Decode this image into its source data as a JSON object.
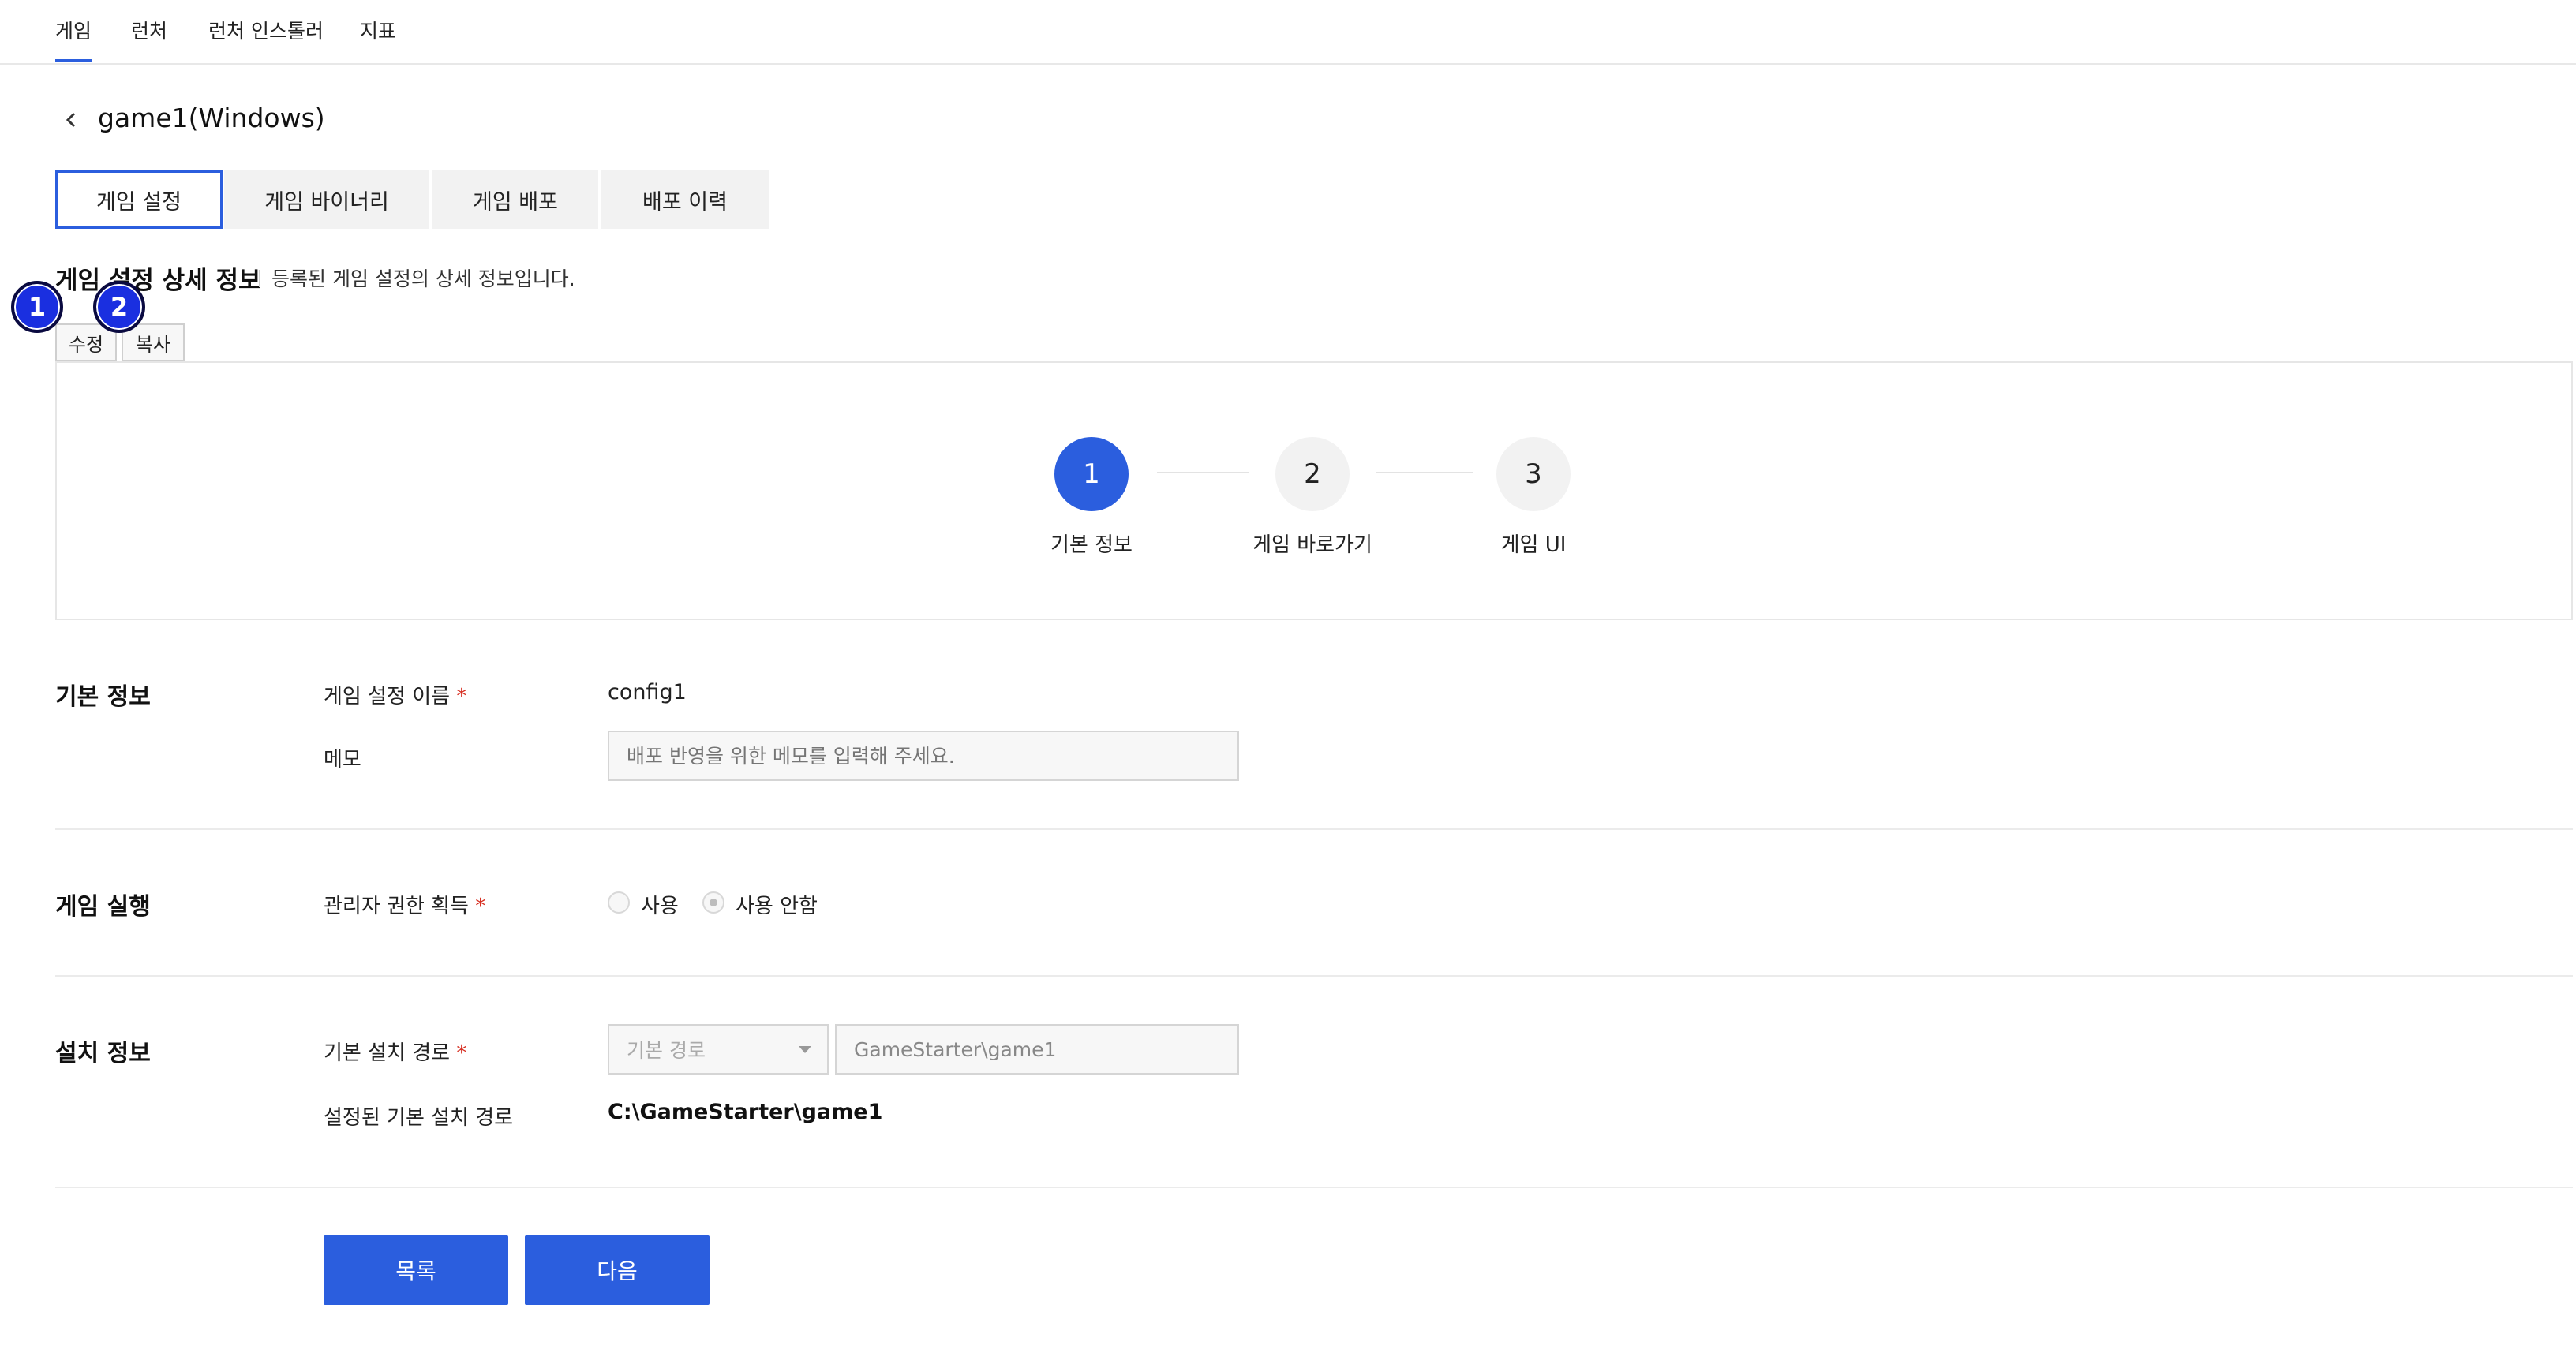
{
  "nav": {
    "items": [
      {
        "label": "게임",
        "active": true
      },
      {
        "label": "런처",
        "active": false
      },
      {
        "label": "런처 인스톨러",
        "active": false
      },
      {
        "label": "지표",
        "active": false
      }
    ]
  },
  "header": {
    "back_icon": "chevron-left-icon",
    "title": "game1(Windows)"
  },
  "tabs": [
    {
      "label": "게임 설정",
      "active": true
    },
    {
      "label": "게임 바이너리",
      "active": false
    },
    {
      "label": "게임 배포",
      "active": false
    },
    {
      "label": "배포 이력",
      "active": false
    }
  ],
  "section": {
    "title": "게임 설정 상세 정보",
    "description": "등록된 게임 설정의 상세 정보입니다.",
    "markers": [
      "1",
      "2"
    ],
    "edit_label": "수정",
    "copy_label": "복사"
  },
  "stepper": {
    "steps": [
      {
        "number": "1",
        "label": "기본 정보",
        "active": true
      },
      {
        "number": "2",
        "label": "게임 바로가기",
        "active": false
      },
      {
        "number": "3",
        "label": "게임 UI",
        "active": false
      }
    ]
  },
  "basic_info": {
    "title": "기본 정보",
    "name_label": "게임 설정 이름",
    "required_mark": "*",
    "name_value": "config1",
    "memo_label": "메모",
    "memo_placeholder": "배포 반영을 위한 메모를 입력해 주세요."
  },
  "game_run": {
    "title": "게임 실행",
    "admin_label": "관리자 권한 획득",
    "required_mark": "*",
    "options": [
      {
        "label": "사용",
        "checked": false
      },
      {
        "label": "사용 안함",
        "checked": true
      }
    ]
  },
  "install_info": {
    "title": "설치 정보",
    "path_label": "기본 설치 경로",
    "required_mark": "*",
    "path_select": "기본 경로",
    "path_input": "GameStarter\\game1",
    "configured_label": "설정된 기본 설치 경로",
    "configured_value": "C:\\GameStarter\\game1"
  },
  "buttons": {
    "list_label": "목록",
    "next_label": "다음"
  },
  "colors": {
    "accent": "#2b5ede",
    "required": "#d62d20",
    "marker": "#1a2fe0"
  }
}
